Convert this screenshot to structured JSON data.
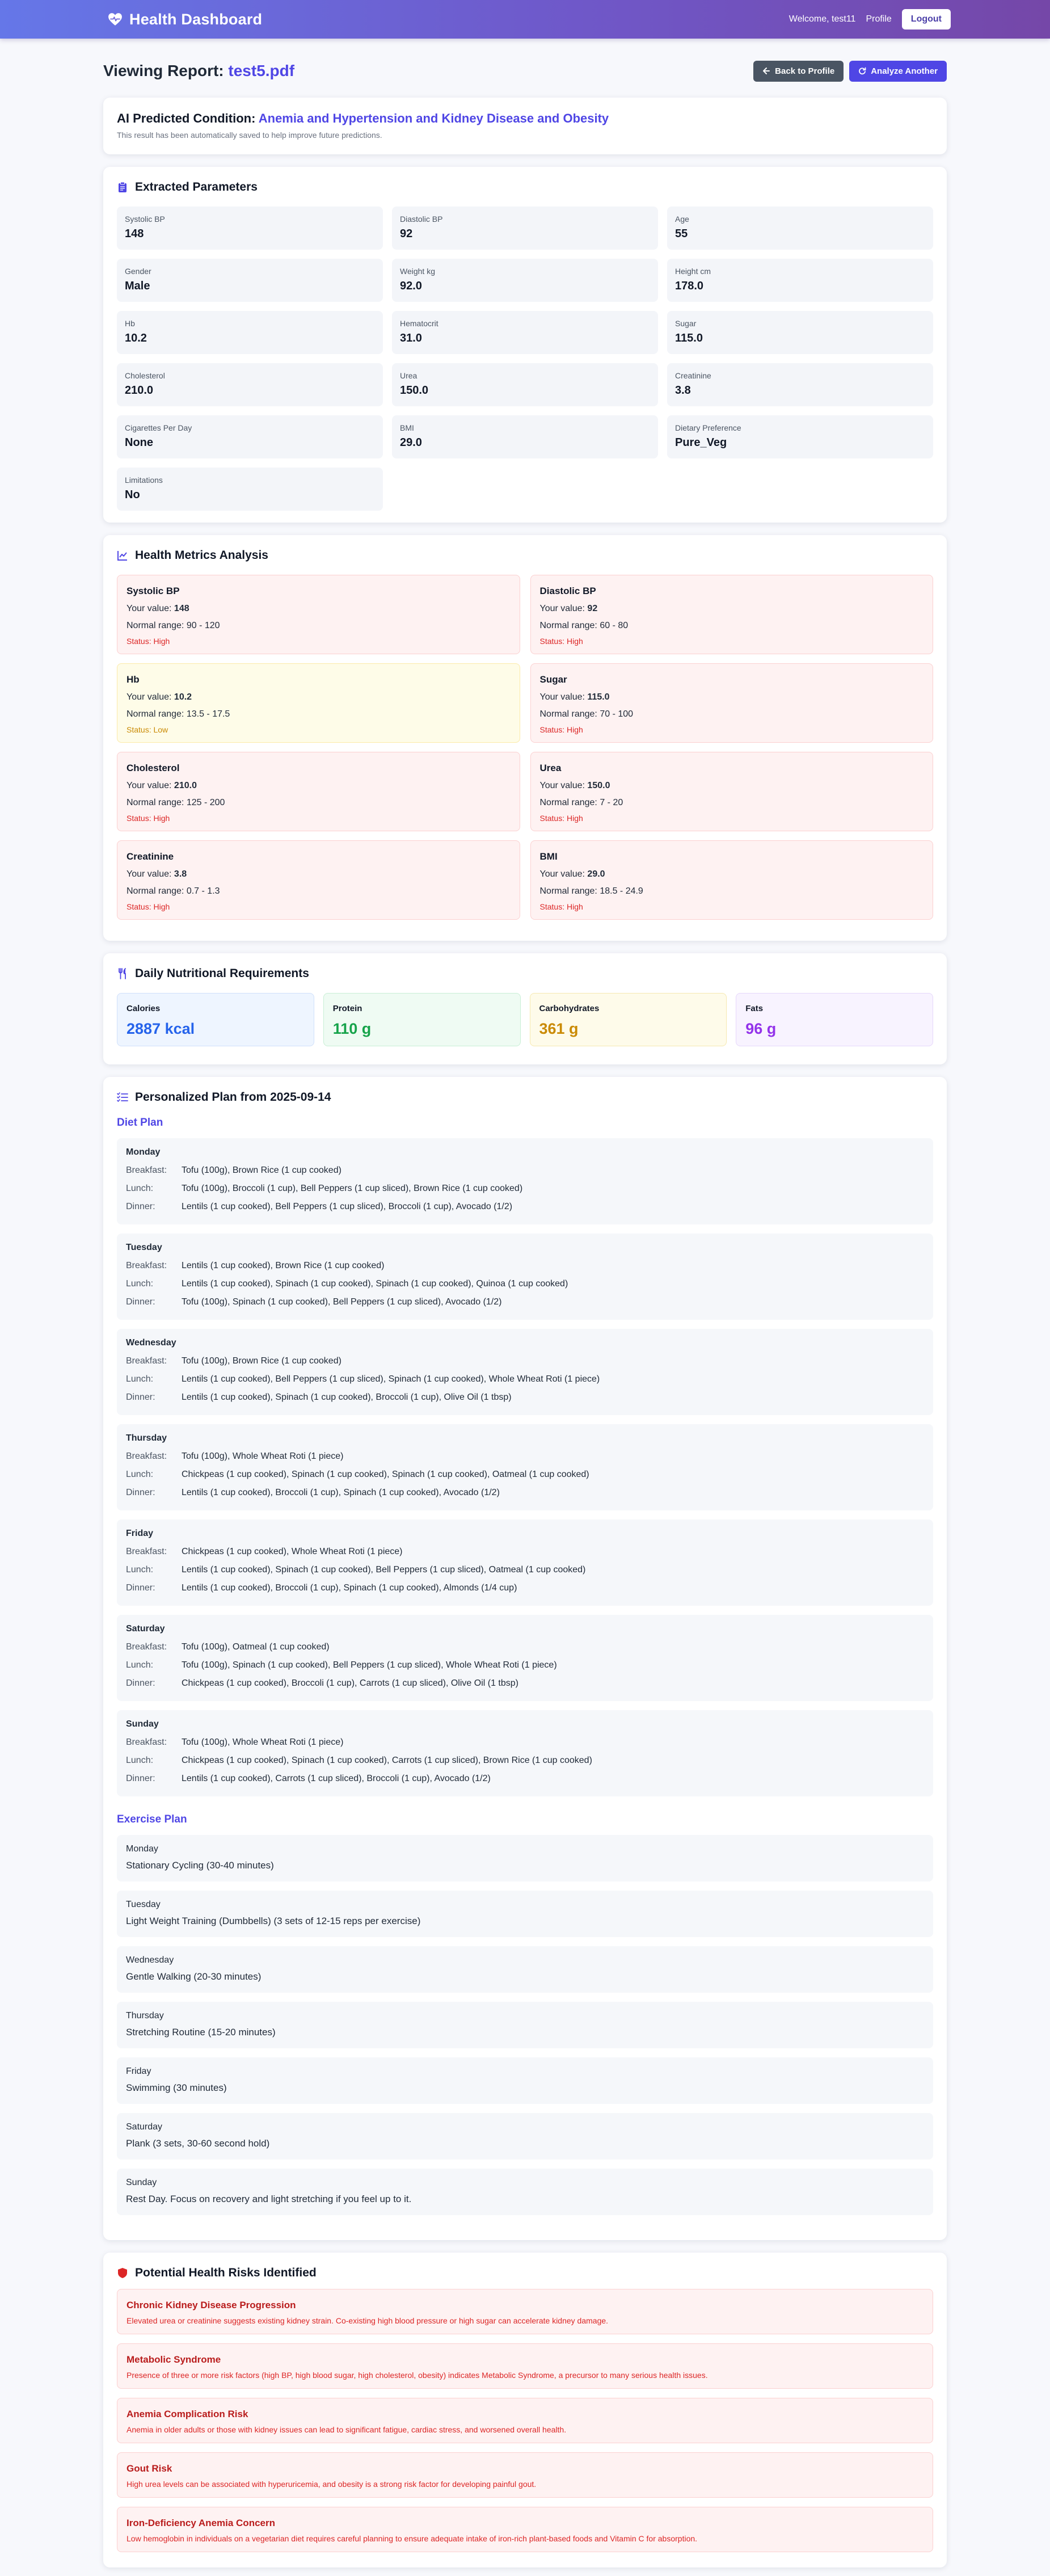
{
  "header": {
    "brand": "Health Dashboard",
    "welcome": "Welcome, test11",
    "profile_link": "Profile",
    "logout_label": "Logout"
  },
  "page": {
    "title_prefix": "Viewing Report:",
    "file_name": "test5.pdf",
    "back_label": "Back to Profile",
    "analyze_label": "Analyze Another"
  },
  "prediction": {
    "label": "AI Predicted Condition:",
    "condition": "Anemia and Hypertension and Kidney Disease and Obesity",
    "note": "This result has been automatically saved to help improve future predictions."
  },
  "parameters": {
    "title": "Extracted Parameters",
    "items": [
      {
        "label": "Systolic BP",
        "value": "148"
      },
      {
        "label": "Diastolic BP",
        "value": "92"
      },
      {
        "label": "Age",
        "value": "55"
      },
      {
        "label": "Gender",
        "value": "Male"
      },
      {
        "label": "Weight kg",
        "value": "92.0"
      },
      {
        "label": "Height cm",
        "value": "178.0"
      },
      {
        "label": "Hb",
        "value": "10.2"
      },
      {
        "label": "Hematocrit",
        "value": "31.0"
      },
      {
        "label": "Sugar",
        "value": "115.0"
      },
      {
        "label": "Cholesterol",
        "value": "210.0"
      },
      {
        "label": "Urea",
        "value": "150.0"
      },
      {
        "label": "Creatinine",
        "value": "3.8"
      },
      {
        "label": "Cigarettes Per Day",
        "value": "None"
      },
      {
        "label": "BMI",
        "value": "29.0"
      },
      {
        "label": "Dietary Preference",
        "value": "Pure_Veg"
      },
      {
        "label": "Limitations",
        "value": "No"
      }
    ]
  },
  "metrics": {
    "title": "Health Metrics Analysis",
    "your_value_label": "Your value:",
    "normal_range_label": "Normal range:",
    "items": [
      {
        "name": "Systolic BP",
        "value": "148",
        "range": "90 - 120",
        "status": "Status: High",
        "level": "high"
      },
      {
        "name": "Diastolic BP",
        "value": "92",
        "range": "60 - 80",
        "status": "Status: High",
        "level": "high"
      },
      {
        "name": "Hb",
        "value": "10.2",
        "range": "13.5 - 17.5",
        "status": "Status: Low",
        "level": "low"
      },
      {
        "name": "Sugar",
        "value": "115.0",
        "range": "70 - 100",
        "status": "Status: High",
        "level": "high"
      },
      {
        "name": "Cholesterol",
        "value": "210.0",
        "range": "125 - 200",
        "status": "Status: High",
        "level": "high"
      },
      {
        "name": "Urea",
        "value": "150.0",
        "range": "7 - 20",
        "status": "Status: High",
        "level": "high"
      },
      {
        "name": "Creatinine",
        "value": "3.8",
        "range": "0.7 - 1.3",
        "status": "Status: High",
        "level": "high"
      },
      {
        "name": "BMI",
        "value": "29.0",
        "range": "18.5 - 24.9",
        "status": "Status: High",
        "level": "high"
      }
    ]
  },
  "nutrition": {
    "title": "Daily Nutritional Requirements",
    "items": [
      {
        "label": "Calories",
        "value": "2887 kcal",
        "bg": "#eef5ff",
        "color": "#2563eb",
        "border": "#cfe0fb"
      },
      {
        "label": "Protein",
        "value": "110 g",
        "bg": "#effbf3",
        "color": "#16a34a",
        "border": "#c8efd5"
      },
      {
        "label": "Carbohydrates",
        "value": "361 g",
        "bg": "#fefbea",
        "color": "#ca8a04",
        "border": "#f6e9b0"
      },
      {
        "label": "Fats",
        "value": "96 g",
        "bg": "#f8f3ff",
        "color": "#9333ea",
        "border": "#e6d7fb"
      }
    ]
  },
  "plan": {
    "title": "Personalized Plan from 2025-09-14",
    "diet_title": "Diet Plan",
    "meal_labels": {
      "breakfast": "Breakfast:",
      "lunch": "Lunch:",
      "dinner": "Dinner:"
    },
    "diet": [
      {
        "day": "Monday",
        "breakfast": "Tofu (100g), Brown Rice (1 cup cooked)",
        "lunch": "Tofu (100g), Broccoli (1 cup), Bell Peppers (1 cup sliced), Brown Rice (1 cup cooked)",
        "dinner": "Lentils (1 cup cooked), Bell Peppers (1 cup sliced), Broccoli (1 cup), Avocado (1/2)"
      },
      {
        "day": "Tuesday",
        "breakfast": "Lentils (1 cup cooked), Brown Rice (1 cup cooked)",
        "lunch": "Lentils (1 cup cooked), Spinach (1 cup cooked), Spinach (1 cup cooked), Quinoa (1 cup cooked)",
        "dinner": "Tofu (100g), Spinach (1 cup cooked), Bell Peppers (1 cup sliced), Avocado (1/2)"
      },
      {
        "day": "Wednesday",
        "breakfast": "Tofu (100g), Brown Rice (1 cup cooked)",
        "lunch": "Lentils (1 cup cooked), Bell Peppers (1 cup sliced), Spinach (1 cup cooked), Whole Wheat Roti (1 piece)",
        "dinner": "Lentils (1 cup cooked), Spinach (1 cup cooked), Broccoli (1 cup), Olive Oil (1 tbsp)"
      },
      {
        "day": "Thursday",
        "breakfast": "Tofu (100g), Whole Wheat Roti (1 piece)",
        "lunch": "Chickpeas (1 cup cooked), Spinach (1 cup cooked), Spinach (1 cup cooked), Oatmeal (1 cup cooked)",
        "dinner": "Lentils (1 cup cooked), Broccoli (1 cup), Spinach (1 cup cooked), Avocado (1/2)"
      },
      {
        "day": "Friday",
        "breakfast": "Chickpeas (1 cup cooked), Whole Wheat Roti (1 piece)",
        "lunch": "Lentils (1 cup cooked), Spinach (1 cup cooked), Bell Peppers (1 cup sliced), Oatmeal (1 cup cooked)",
        "dinner": "Lentils (1 cup cooked), Broccoli (1 cup), Spinach (1 cup cooked), Almonds (1/4 cup)"
      },
      {
        "day": "Saturday",
        "breakfast": "Tofu (100g), Oatmeal (1 cup cooked)",
        "lunch": "Tofu (100g), Spinach (1 cup cooked), Bell Peppers (1 cup sliced), Whole Wheat Roti (1 piece)",
        "dinner": "Chickpeas (1 cup cooked), Broccoli (1 cup), Carrots (1 cup sliced), Olive Oil (1 tbsp)"
      },
      {
        "day": "Sunday",
        "breakfast": "Tofu (100g), Whole Wheat Roti (1 piece)",
        "lunch": "Chickpeas (1 cup cooked), Spinach (1 cup cooked), Carrots (1 cup sliced), Brown Rice (1 cup cooked)",
        "dinner": "Lentils (1 cup cooked), Carrots (1 cup sliced), Broccoli (1 cup), Avocado (1/2)"
      }
    ],
    "exercise_title": "Exercise Plan",
    "exercise": [
      {
        "day": "Monday",
        "activity": "Stationary Cycling (30-40 minutes)"
      },
      {
        "day": "Tuesday",
        "activity": "Light Weight Training (Dumbbells) (3 sets of 12-15 reps per exercise)"
      },
      {
        "day": "Wednesday",
        "activity": "Gentle Walking (20-30 minutes)"
      },
      {
        "day": "Thursday",
        "activity": "Stretching Routine (15-20 minutes)"
      },
      {
        "day": "Friday",
        "activity": "Swimming (30 minutes)"
      },
      {
        "day": "Saturday",
        "activity": "Plank (3 sets, 30-60 second hold)"
      },
      {
        "day": "Sunday",
        "activity": "Rest Day. Focus on recovery and light stretching if you feel up to it."
      }
    ]
  },
  "risks": {
    "title": "Potential Health Risks Identified",
    "items": [
      {
        "name": "Chronic Kidney Disease Progression",
        "desc": "Elevated urea or creatinine suggests existing kidney strain. Co-existing high blood pressure or high sugar can accelerate kidney damage."
      },
      {
        "name": "Metabolic Syndrome",
        "desc": "Presence of three or more risk factors (high BP, high blood sugar, high cholesterol, obesity) indicates Metabolic Syndrome, a precursor to many serious health issues."
      },
      {
        "name": "Anemia Complication Risk",
        "desc": "Anemia in older adults or those with kidney issues can lead to significant fatigue, cardiac stress, and worsened overall health."
      },
      {
        "name": "Gout Risk",
        "desc": "High urea levels can be associated with hyperuricemia, and obesity is a strong risk factor for developing painful gout."
      },
      {
        "name": "Iron-Deficiency Anemia Concern",
        "desc": "Low hemoglobin in individuals on a vegetarian diet requires careful planning to ensure adequate intake of iron-rich plant-based foods and Vitamin C for absorption."
      }
    ]
  }
}
